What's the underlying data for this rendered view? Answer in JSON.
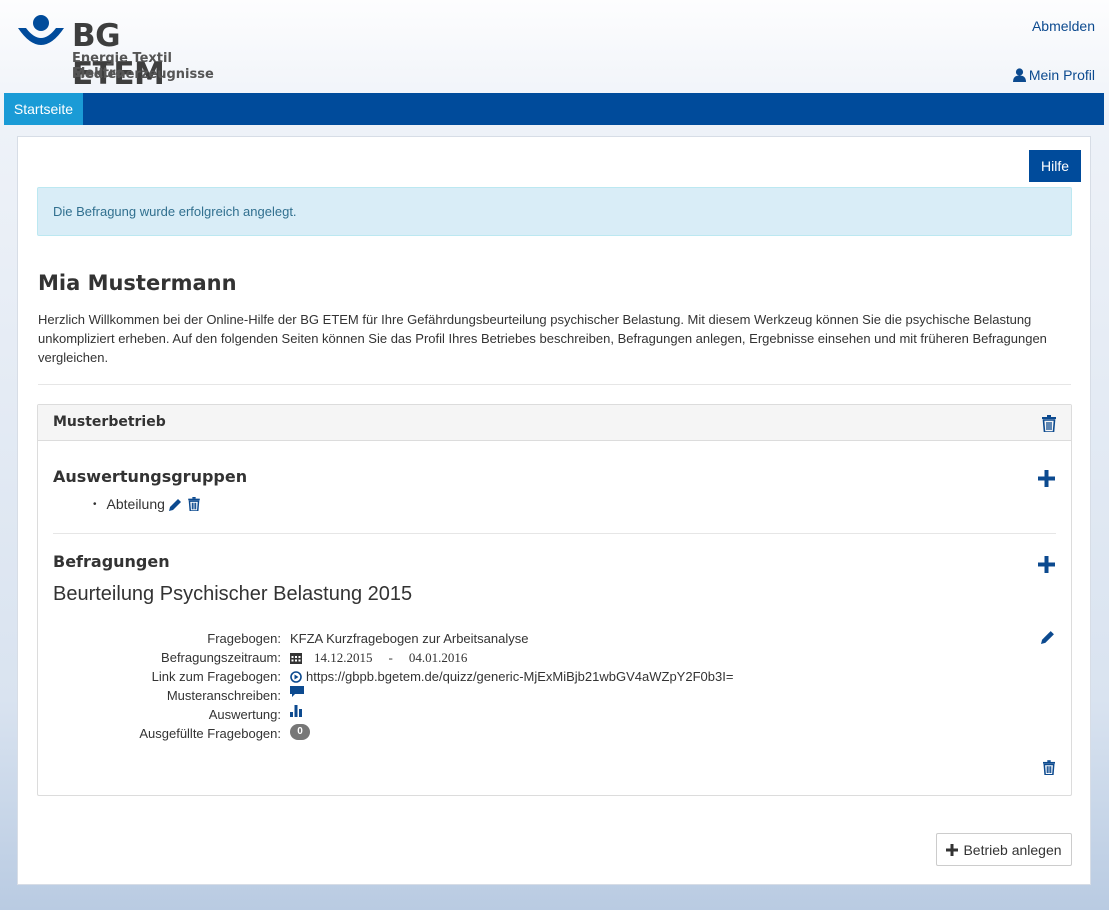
{
  "header": {
    "logo_text": "BG ETEM",
    "logo_sub1": "Energie Textil Elektro",
    "logo_sub2": "Medienerzeugnisse",
    "logout_label": "Abmelden",
    "profile_label": "Mein Profil",
    "profile_icon": "user-icon"
  },
  "nav": {
    "tabs": [
      {
        "label": "Startseite",
        "active": true
      }
    ]
  },
  "main": {
    "help_label": "Hilfe",
    "alert_text": "Die Befragung wurde erfolgreich angelegt.",
    "user_name": "Mia Mustermann",
    "intro": "Herzlich Willkommen bei der Online-Hilfe der BG ETEM für Ihre Gefährdungsbeurteilung psychischer Belastung. Mit diesem Werkzeug können Sie die psychische Belastung unkompliziert erheben. Auf den folgenden Seiten können Sie das Profil Ihres Betriebes beschreiben, Befragungen anlegen, Ergebnisse einsehen und mit früheren Befragungen vergleichen.",
    "company": {
      "name": "Musterbetrieb",
      "groups_title": "Auswertungsgruppen",
      "groups": [
        {
          "label": "Abteilung"
        }
      ],
      "surveys_title": "Befragungen",
      "survey": {
        "title": "Beurteilung Psychischer Belastung 2015",
        "rows": {
          "questionnaire": {
            "label": "Fragebogen:",
            "value": "KFZA Kurzfragebogen zur Arbeitsanalyse"
          },
          "period": {
            "label": "Befragungszeitraum:",
            "start": "14.12.2015",
            "sep": "-",
            "end": "04.01.2016"
          },
          "link": {
            "label": "Link zum Fragebogen:",
            "value": "https://gbpb.bgetem.de/quizz/generic-MjExMiBjb21wbGV4aWZpY2F0b3I="
          },
          "letter": {
            "label": "Musteranschreiben:"
          },
          "evaluation": {
            "label": "Auswertung:"
          },
          "completed": {
            "label": "Ausgefüllte Fragebogen:",
            "value": "0"
          }
        }
      }
    },
    "add_company_label": "Betrieb anlegen"
  },
  "colors": {
    "brand": "#004b9b",
    "tab_active": "#1a9bd6",
    "link": "#0c4a8f",
    "alert_bg": "#d9edf7",
    "alert_text": "#31708f"
  }
}
